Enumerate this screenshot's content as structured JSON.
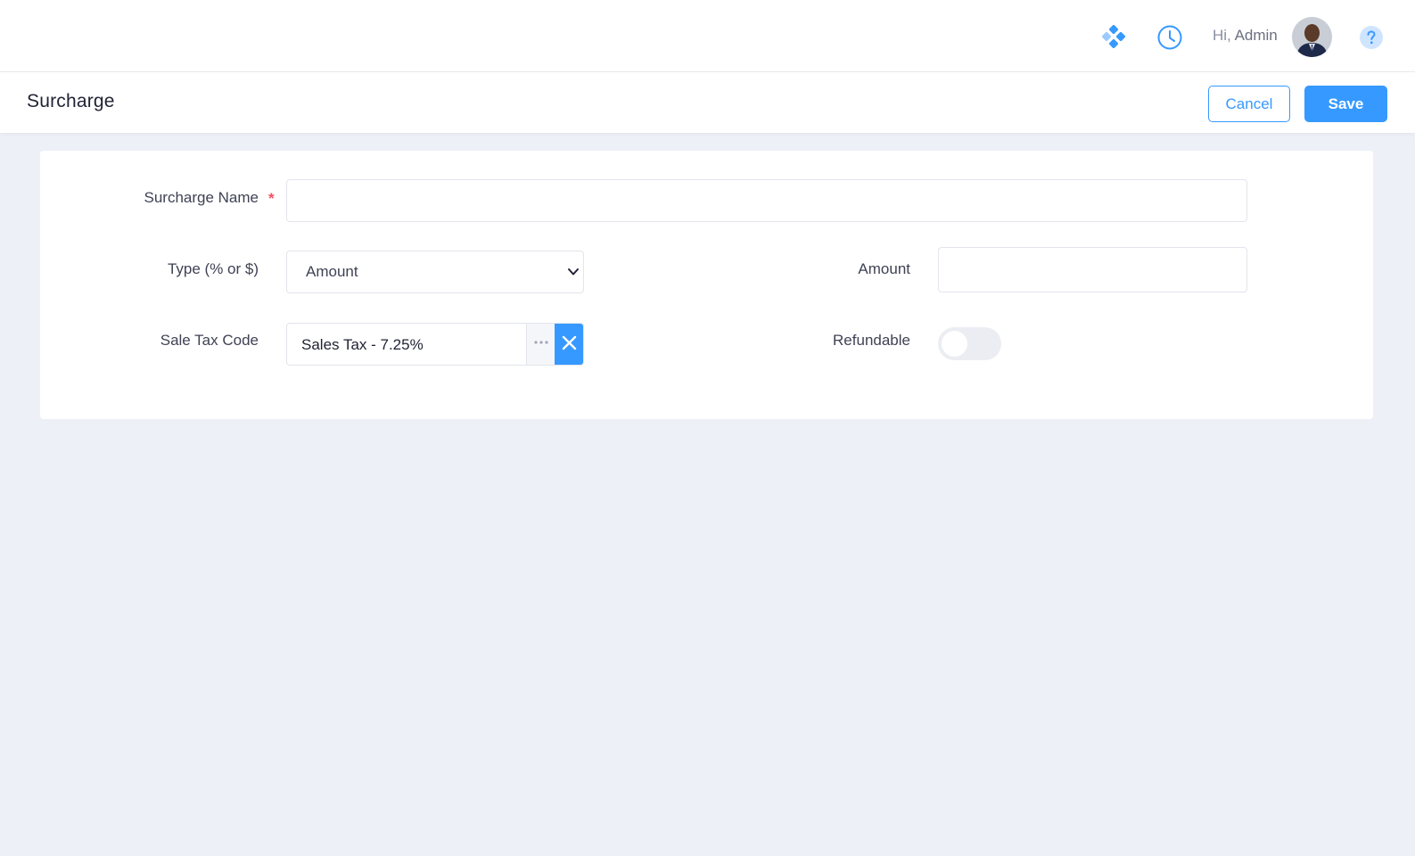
{
  "header": {
    "greeting_prefix": "Hi,",
    "greeting_name": "Admin",
    "icons": [
      "apps-icon",
      "history-clock-icon",
      "avatar",
      "help-icon"
    ]
  },
  "toolbar": {
    "page_title": "Surcharge",
    "cancel_label": "Cancel",
    "save_label": "Save"
  },
  "form": {
    "surcharge_name": {
      "label": "Surcharge Name",
      "required_mark": "*",
      "value": "",
      "required": true
    },
    "type": {
      "label": "Type (% or $)",
      "value": "Amount"
    },
    "amount": {
      "label": "Amount",
      "value": ""
    },
    "sale_tax_code": {
      "label": "Sale Tax Code",
      "value": "Sales Tax - 7.25%"
    },
    "refundable": {
      "label": "Refundable",
      "checked": false
    }
  },
  "colors": {
    "accent": "#3699ff",
    "required": "#f64e60",
    "background": "#edf0f7"
  }
}
